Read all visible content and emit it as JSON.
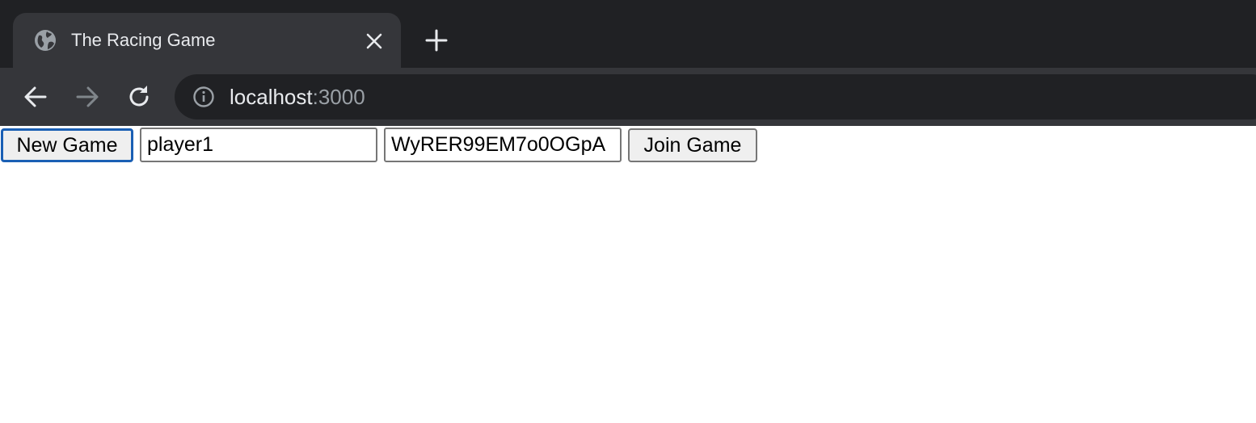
{
  "browser": {
    "tab": {
      "title": "The Racing Game",
      "icon": "globe-icon",
      "close_icon": "close-icon"
    },
    "new_tab_icon": "plus-icon",
    "nav": {
      "back_icon": "arrow-left-icon",
      "forward_icon": "arrow-right-icon",
      "reload_icon": "reload-icon"
    },
    "address": {
      "info_icon": "info-icon",
      "host": "localhost",
      "port": ":3000"
    },
    "colors": {
      "tabstrip_bg": "#202124",
      "toolbar_bg": "#35363a",
      "omnibox_bg": "#202124",
      "text": "#e8eaed",
      "muted_text": "#9aa0a6"
    }
  },
  "page": {
    "new_game_label": "New Game",
    "player_name_value": "player1",
    "game_id_value": "WyRER99EM7o0OGpA",
    "join_game_label": "Join Game"
  }
}
